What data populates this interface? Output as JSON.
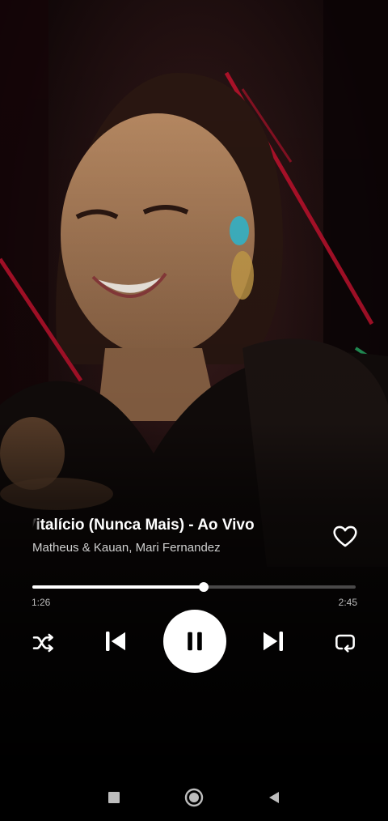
{
  "track": {
    "title": "Vitalício (Nunca Mais) - Ao Vivo",
    "artists": "Matheus & Kauan, Mari Fernandez",
    "liked": false
  },
  "progress": {
    "elapsed": "1:26",
    "total": "2:45",
    "fraction": 0.53
  },
  "controls": {
    "shuffle_icon": "shuffle-icon",
    "previous_icon": "skip-previous-icon",
    "play_state": "playing",
    "play_pause_icon": "pause-icon",
    "next_icon": "skip-next-icon",
    "repeat_icon": "repeat-icon"
  },
  "navbar": {
    "recents_icon": "square-icon",
    "home_icon": "circle-icon",
    "back_icon": "triangle-back-icon"
  },
  "colors": {
    "background": "#000000",
    "text_primary": "#ffffff",
    "text_secondary": "#cfcfcf",
    "accent_stage": "#c4122e"
  }
}
